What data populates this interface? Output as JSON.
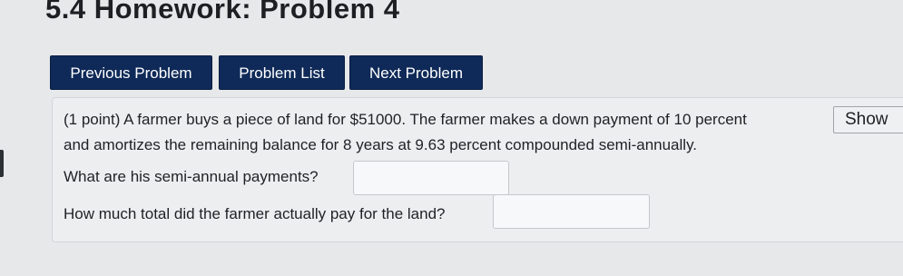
{
  "page": {
    "title": "5.4 Homework: Problem 4"
  },
  "nav": {
    "previous_label": "Previous Problem",
    "list_label": "Problem List",
    "next_label": "Next Problem"
  },
  "problem": {
    "statement_line1": "(1 point) A farmer buys a piece of land for $51000. The farmer makes a down payment of 10 percent",
    "statement_line2": "and amortizes the remaining balance for 8 years at 9.63 percent compounded semi-annually.",
    "question1": "What are his semi-annual payments?",
    "answer1_value": "",
    "question2": "How much total did the farmer actually pay for the land?",
    "answer2_value": "",
    "show_button_label": "Show"
  },
  "colors": {
    "nav_button_bg": "#0f2a58",
    "nav_button_text": "#ffffff",
    "page_bg": "#e6e8ea"
  }
}
